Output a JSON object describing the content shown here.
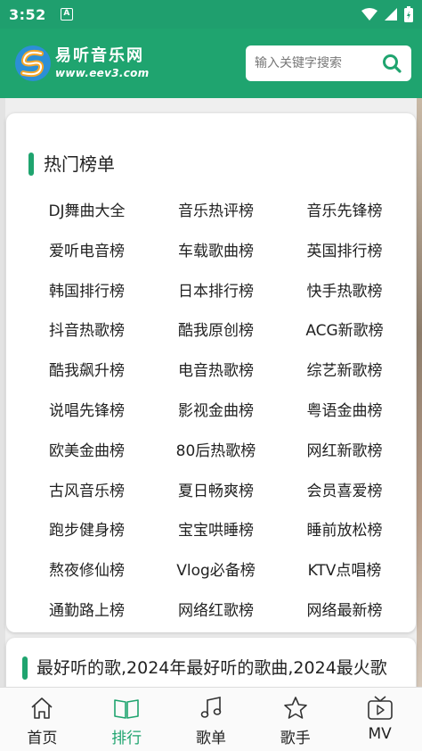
{
  "status_bar": {
    "time": "3:52",
    "app_icon": "A"
  },
  "header": {
    "logo_name": "易听音乐网",
    "logo_url": "www.eev3.com",
    "search_placeholder": "输入关键字搜索"
  },
  "hot_charts": {
    "title": "热门榜单",
    "items": [
      "DJ舞曲大全",
      "音乐热评榜",
      "音乐先锋榜",
      "爱听电音榜",
      "车载歌曲榜",
      "英国排行榜",
      "韩国排行榜",
      "日本排行榜",
      "快手热歌榜",
      "抖音热歌榜",
      "酷我原创榜",
      "ACG新歌榜",
      "酷我飙升榜",
      "电音热歌榜",
      "综艺新歌榜",
      "说唱先锋榜",
      "影视金曲榜",
      "粤语金曲榜",
      "欧美金曲榜",
      "80后热歌榜",
      "网红新歌榜",
      "古风音乐榜",
      "夏日畅爽榜",
      "会员喜爱榜",
      "跑步健身榜",
      "宝宝哄睡榜",
      "睡前放松榜",
      "熬夜修仙榜",
      "Vlog必备榜",
      "KTV点唱榜",
      "通勤路上榜",
      "网络红歌榜",
      "网络最新榜"
    ]
  },
  "section2": {
    "title": "最好听的歌,2024年最好听的歌曲,2024最火歌"
  },
  "tabbar": {
    "active": "排行",
    "tabs": [
      {
        "label": "首页",
        "icon": "home-icon"
      },
      {
        "label": "排行",
        "icon": "book-icon"
      },
      {
        "label": "歌单",
        "icon": "music-note-icon"
      },
      {
        "label": "歌手",
        "icon": "star-icon"
      },
      {
        "label": "MV",
        "icon": "tv-icon"
      }
    ]
  },
  "colors": {
    "brand": "#1fa46f",
    "status_bar": "#1f9f6e"
  }
}
